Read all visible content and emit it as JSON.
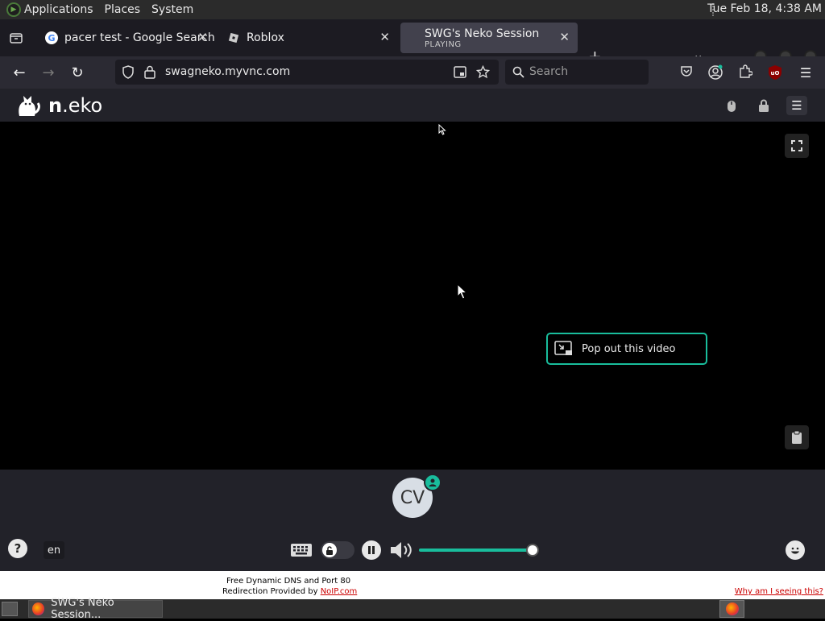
{
  "system_bar": {
    "menus": [
      "Applications",
      "Places",
      "System"
    ],
    "clock": "Tue Feb 18,  4:38 AM"
  },
  "browser": {
    "tabs": [
      {
        "title": "pacer test - Google Search",
        "favicon": "google-icon",
        "active": false
      },
      {
        "title": "Roblox",
        "favicon": "roblox-icon",
        "active": false
      },
      {
        "title": "SWG's Neko Session",
        "subtitle": "PLAYING",
        "favicon": "none",
        "active": true
      }
    ],
    "url": "swagneko.myvnc.com",
    "search_placeholder": "Search"
  },
  "neko": {
    "brand_bold": "n",
    "brand_rest": ".eko",
    "popout_label": "Pop out this video",
    "avatar_initials": "CV",
    "language": "en",
    "volume_fraction": 1.0,
    "accent_color": "#19bd9c"
  },
  "noip_banner": {
    "line1": "Free Dynamic DNS and Port 80",
    "line2_prefix": "Redirection Provided by ",
    "line2_link": "NoIP.com",
    "why_link": "Why am I seeing this?"
  },
  "taskbar": {
    "task_label": "SWG's Neko Session..."
  }
}
